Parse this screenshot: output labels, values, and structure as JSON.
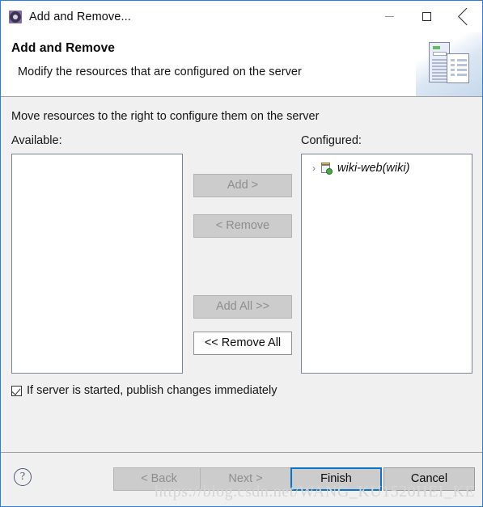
{
  "window": {
    "title": "Add and Remove...",
    "icon": "gear-icon",
    "controls": {
      "minimize": "minimize-icon",
      "maximize": "maximize-icon",
      "close": "close-icon"
    }
  },
  "banner": {
    "title": "Add and Remove",
    "subtitle": "Modify the resources that are configured on the server",
    "art_icon": "server-and-document-icon"
  },
  "main": {
    "instruction": "Move resources to the right to configure them on the server",
    "available": {
      "label": "Available:",
      "items": []
    },
    "configured": {
      "label": "Configured:",
      "items": [
        {
          "label": "wiki-web(wiki)",
          "chevron": "›",
          "icon": "web-module-icon",
          "expanded": false
        }
      ]
    },
    "transfer_buttons": [
      {
        "label": "Add >",
        "enabled": false
      },
      {
        "label": "< Remove",
        "enabled": false
      },
      {
        "label": "Add All >>",
        "enabled": false
      },
      {
        "label": "<< Remove All",
        "enabled": true
      }
    ],
    "publish_checkbox": {
      "label": "If server is started, publish changes immediately",
      "checked": true
    }
  },
  "footer": {
    "help": "?",
    "buttons": [
      {
        "label": "< Back",
        "enabled": false
      },
      {
        "label": "Next >",
        "enabled": false
      },
      {
        "label": "Finish",
        "enabled": true,
        "default": true
      },
      {
        "label": "Cancel",
        "enabled": true
      }
    ]
  },
  "watermark": "https://blog.csdn.net/WANG_KU1520HEI_KE",
  "colors": {
    "frame": "#2a7fd4",
    "dialog_bg": "#f0f0f0",
    "focus_border": "#0a72c8",
    "disabled_text": "#8e8e8e"
  }
}
